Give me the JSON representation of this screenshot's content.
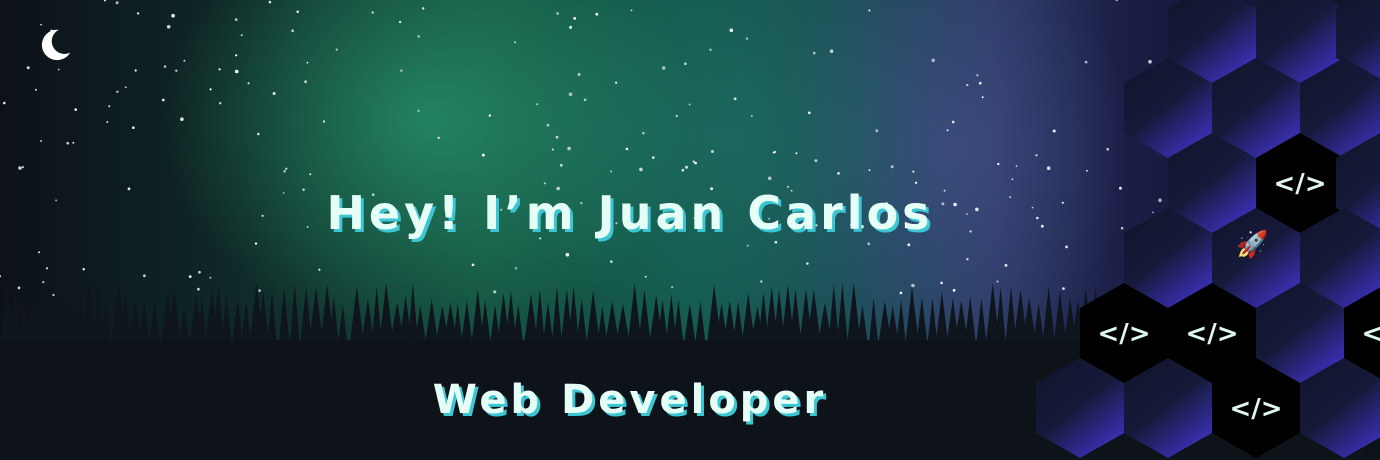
{
  "banner": {
    "greeting": "Hey! I’m Juan Carlos",
    "role": "Web Developer",
    "code_symbol": "</>",
    "icons": [
      "moon-icon",
      "rocket-icon",
      "code-icon"
    ],
    "colors": {
      "text": "#e6fff6",
      "text_shadow": "#3cc6d4",
      "hex_accent": "#3b30b8",
      "aurora": "#14503f"
    }
  }
}
